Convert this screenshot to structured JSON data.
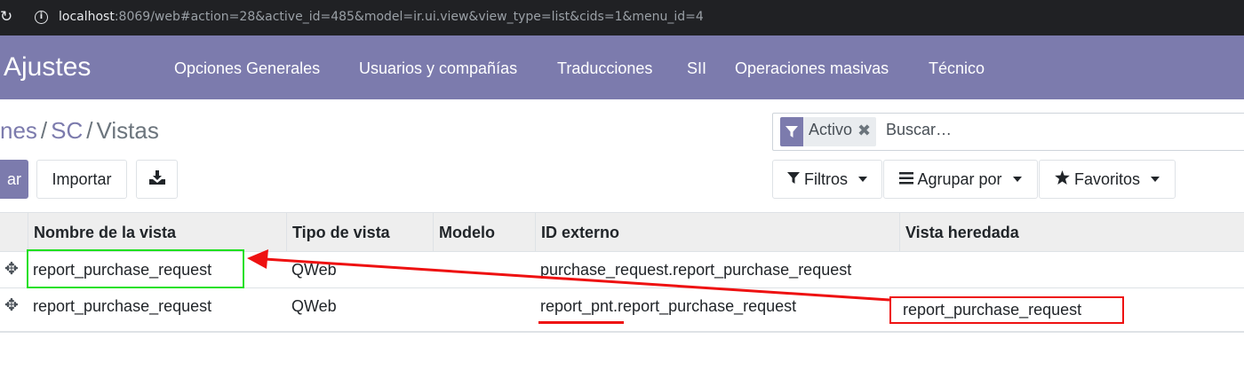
{
  "browser": {
    "url_host": "localhost",
    "url_rest": ":8069/web#action=28&active_id=485&model=ir.ui.view&view_type=list&cids=1&menu_id=4"
  },
  "navbar": {
    "app_name": "Ajustes",
    "menu": [
      "Opciones Generales",
      "Usuarios y compañías",
      "Traducciones",
      "SII",
      "Operaciones masivas",
      "Técnico"
    ]
  },
  "breadcrumb": {
    "first": "nes",
    "second": "SC",
    "current": "Vistas",
    "separator": "/"
  },
  "search": {
    "facet_label": "Activo",
    "placeholder": "Buscar…"
  },
  "buttons": {
    "create_label": "ar",
    "import_label": "Importar",
    "filters_label": "Filtros",
    "group_label": "Agrupar por",
    "favorites_label": "Favoritos"
  },
  "table": {
    "columns": [
      "Nombre de la vista",
      "Tipo de vista",
      "Modelo",
      "ID externo",
      "Vista heredada"
    ],
    "rows": [
      {
        "name": "report_purchase_request",
        "type": "QWeb",
        "model": "",
        "xml_id": "purchase_request.report_purchase_request",
        "inherited": ""
      },
      {
        "name": "report_purchase_request",
        "type": "QWeb",
        "model": "",
        "xml_id": "report_pnt.report_purchase_request",
        "inherited": "report_purchase_request"
      }
    ]
  },
  "colors": {
    "brand": "#7c7bad",
    "annotation_green": "#1fe01f",
    "annotation_red": "#ee1111"
  }
}
